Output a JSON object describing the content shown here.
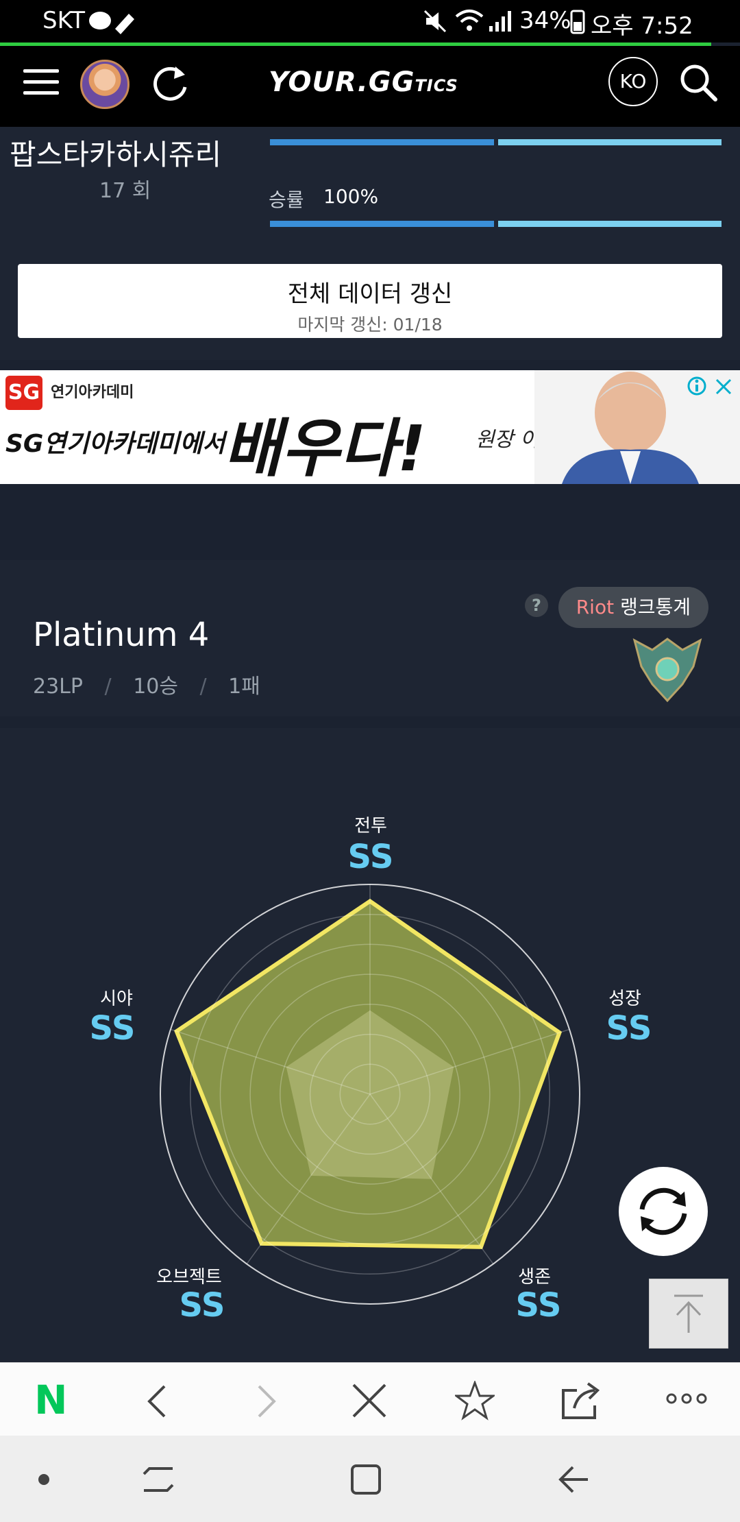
{
  "status_bar": {
    "carrier": "SKT",
    "battery": "34%",
    "time": "오후 7:52"
  },
  "header": {
    "logo_main": "YOUR.GG",
    "logo_suffix": "TICS",
    "lang": "KO",
    "icons": [
      "menu-icon",
      "avatar",
      "refresh-icon",
      "search-icon"
    ]
  },
  "champion": {
    "name": "팝스타카하시쥬리",
    "count": "17 회",
    "winrate_label": "승률",
    "winrate_value": "100%"
  },
  "refresh_all": {
    "title": "전체 데이터 갱신",
    "subtitle": "마지막 갱신: 01/18"
  },
  "ad": {
    "brand": "연기아카데미",
    "tagline": "SG연기아카데미에서",
    "headline": "배우다!",
    "signature": "원장 이순재"
  },
  "rank": {
    "tier": "Platinum 4",
    "lp": "23LP",
    "wins": "10승",
    "losses": "1패",
    "riot_prefix": "Riot",
    "riot_label": "랭크통계",
    "help": "?"
  },
  "radar": {
    "labels": [
      "전투",
      "성장",
      "생존",
      "오브젝트",
      "시야"
    ],
    "grades": [
      "SS",
      "SS",
      "SS",
      "SS",
      "SS"
    ],
    "outer_values": [
      0.92,
      0.95,
      0.9,
      0.88,
      0.97
    ],
    "inner_values": [
      0.4,
      0.42,
      0.5,
      0.48,
      0.42
    ],
    "colors": {
      "fill": "#8d9a4a",
      "stroke": "#f2e663",
      "grade": "#66ccf1"
    }
  },
  "browser_bar": {
    "icons": [
      "naver-icon",
      "back-icon",
      "forward-icon",
      "close-icon",
      "star-icon",
      "share-icon",
      "more-icon"
    ],
    "naver": "N"
  },
  "android_nav": {
    "icons": [
      "dot-icon",
      "recents-icon",
      "home-icon",
      "back-icon"
    ]
  }
}
